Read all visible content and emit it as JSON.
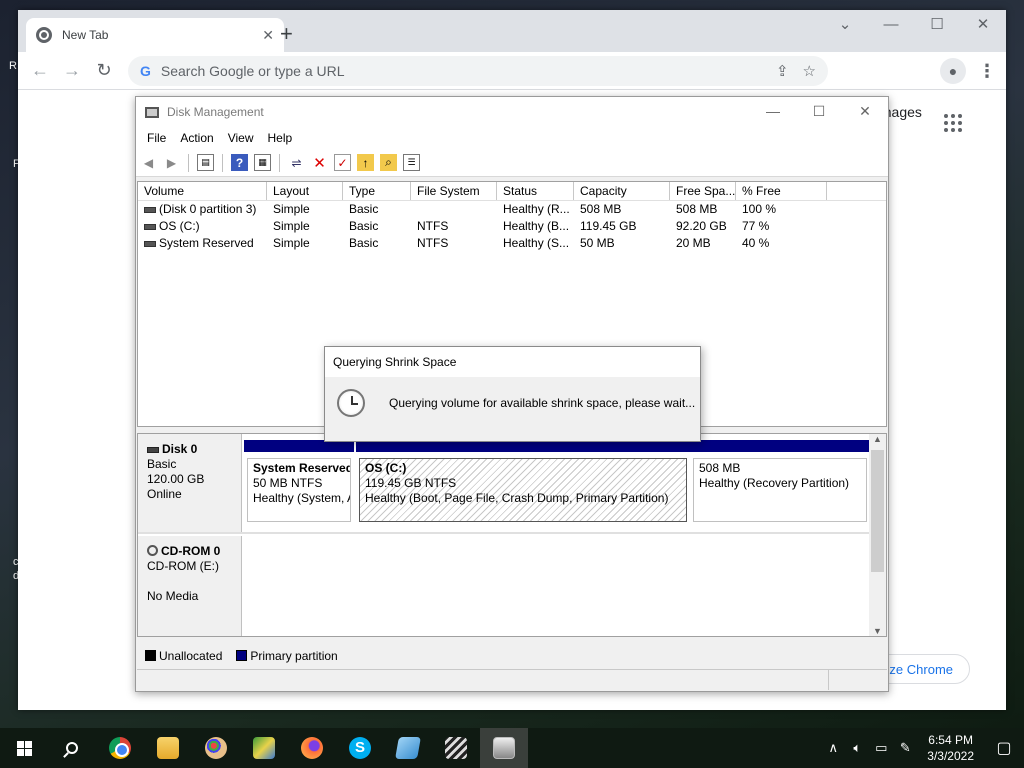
{
  "desktop": {
    "frag_r": "R",
    "frag_f": "F",
    "frag_c": "c",
    "frag_d": "d"
  },
  "chrome": {
    "tab_title": "New Tab",
    "omnibox_placeholder": "Search Google or type a URL",
    "images_link": "Images",
    "customize_label": "Customize Chrome",
    "customize_visible": "tomize Chrome"
  },
  "disk_mgmt": {
    "title": "Disk Management",
    "menu": [
      "File",
      "Action",
      "View",
      "Help"
    ],
    "columns": [
      "Volume",
      "Layout",
      "Type",
      "File System",
      "Status",
      "Capacity",
      "Free Spa...",
      "% Free"
    ],
    "volumes": [
      [
        "(Disk 0 partition 3)",
        "Simple",
        "Basic",
        "",
        "Healthy (R...",
        "508 MB",
        "508 MB",
        "100 %"
      ],
      [
        "OS (C:)",
        "Simple",
        "Basic",
        "NTFS",
        "Healthy (B...",
        "119.45 GB",
        "92.20 GB",
        "77 %"
      ],
      [
        "System Reserved",
        "Simple",
        "Basic",
        "NTFS",
        "Healthy (S...",
        "50 MB",
        "20 MB",
        "40 %"
      ]
    ],
    "disk0": {
      "name": "Disk 0",
      "type": "Basic",
      "size": "120.00 GB",
      "state": "Online",
      "partitions": [
        {
          "name": "System Reserved",
          "size": "50 MB NTFS",
          "status": "Healthy (System, A"
        },
        {
          "name": "OS  (C:)",
          "size": "119.45 GB NTFS",
          "status": "Healthy (Boot, Page File, Crash Dump, Primary Partition)"
        },
        {
          "name": "",
          "size": "508 MB",
          "status": "Healthy (Recovery Partition)"
        }
      ]
    },
    "cdrom0": {
      "name": "CD-ROM 0",
      "drive": "CD-ROM (E:)",
      "media": "No Media"
    },
    "legend": [
      "Unallocated",
      "Primary partition"
    ],
    "colors": {
      "unallocated": "#000000",
      "primary": "#000080"
    }
  },
  "dialog": {
    "title": "Querying Shrink Space",
    "message": "Querying volume for available shrink space, please wait..."
  },
  "taskbar": {
    "time": "6:54 PM",
    "date": "3/3/2022"
  }
}
